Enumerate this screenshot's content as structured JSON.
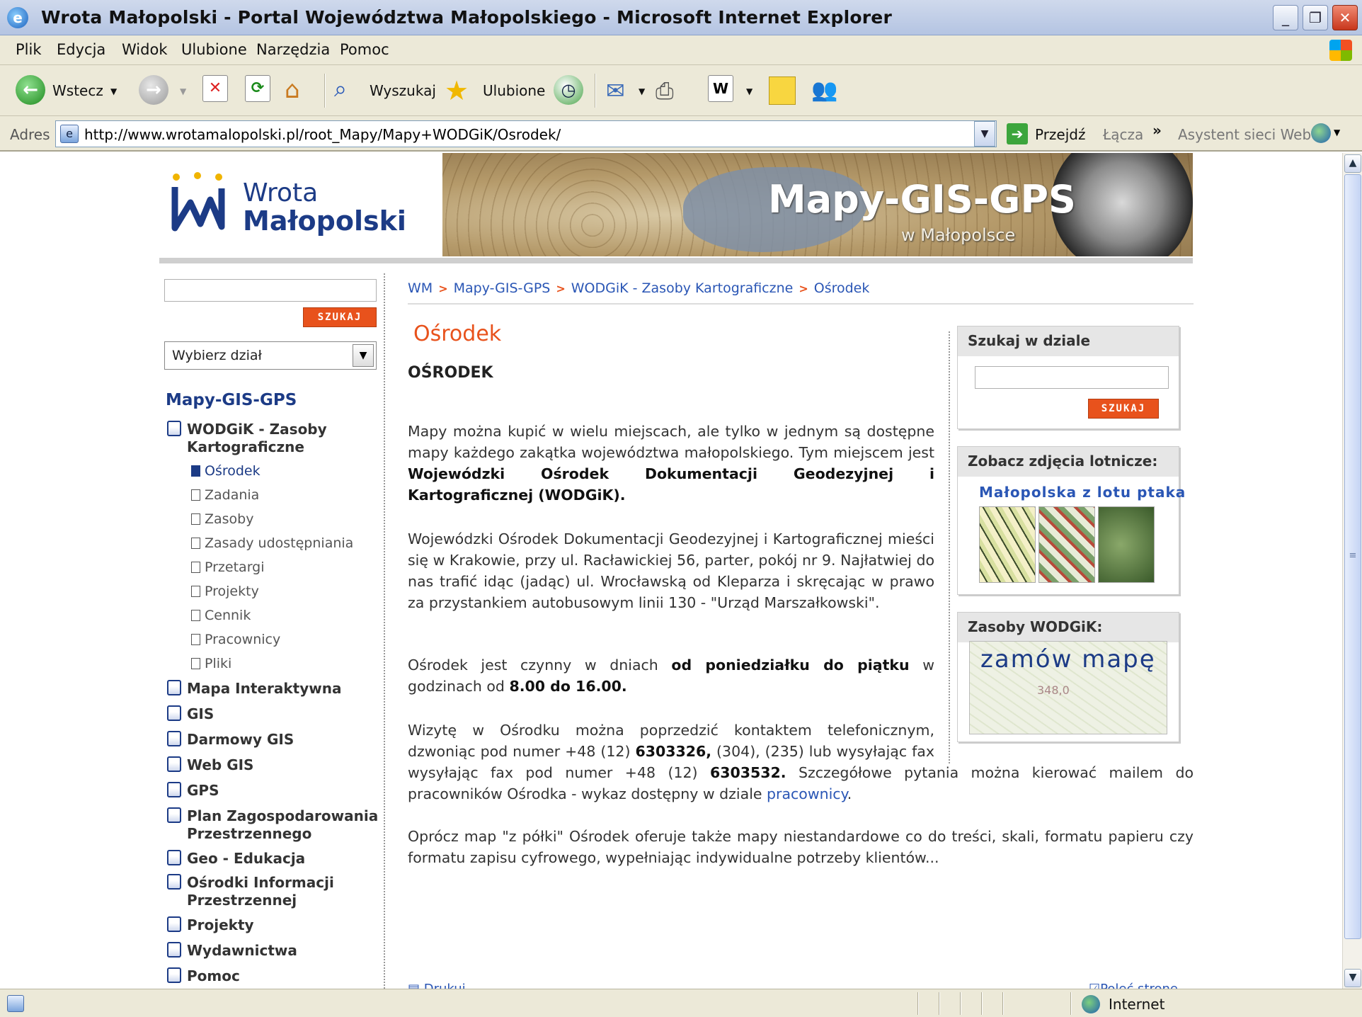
{
  "window": {
    "title": "Wrota Małopolski - Portal Województwa Małopolskiego - Microsoft Internet Explorer",
    "minimize": "_",
    "restore": "❐",
    "close": "✕"
  },
  "menu": [
    "Plik",
    "Edycja",
    "Widok",
    "Ulubione",
    "Narzędzia",
    "Pomoc"
  ],
  "toolbar": {
    "back": "Wstecz",
    "search": "Wyszukaj",
    "favorites": "Ulubione"
  },
  "address": {
    "label": "Adres",
    "url": "http://www.wrotamalopolski.pl/root_Mapy/Mapy+WODGiK/Osrodek/",
    "go": "Przejdź",
    "links": "Łącza",
    "chevron": "»",
    "assistant": "Asystent sieci Web"
  },
  "status": {
    "zone": "Internet"
  },
  "banner": {
    "logo_line1": "Wrota",
    "logo_line2": "Małopolski",
    "title": "Mapy-GIS-GPS",
    "subtitle": "w Małopolsce"
  },
  "left": {
    "search_button": "SZUKAJ",
    "select_value": "Wybierz dział",
    "heading": "Mapy-GIS-GPS",
    "nav_main": [
      {
        "label1": "WODGiK - Zasoby",
        "label2": "Kartograficzne"
      },
      {
        "label1": "Mapa Interaktywna"
      },
      {
        "label1": "GIS"
      },
      {
        "label1": "Darmowy GIS"
      },
      {
        "label1": "Web GIS"
      },
      {
        "label1": "GPS"
      },
      {
        "label1": "Plan Zagospodarowania",
        "label2": "Przestrzennego"
      },
      {
        "label1": "Geo - Edukacja"
      },
      {
        "label1": "Ośrodki Informacji",
        "label2": "Przestrzennej"
      },
      {
        "label1": "Projekty"
      },
      {
        "label1": "Wydawnictwa"
      },
      {
        "label1": "Pomoc"
      }
    ],
    "sub_items": [
      "Ośrodek",
      "Zadania",
      "Zasoby",
      "Zasady udostępniania",
      "Przetargi",
      "Projekty",
      "Cennik",
      "Pracownicy",
      "Pliki"
    ]
  },
  "breadcrumb": [
    "WM",
    "Mapy-GIS-GPS",
    "WODGiK - Zasoby Kartograficzne",
    "Ośrodek"
  ],
  "breadcrumb_sep": ">",
  "main": {
    "title": "Ośrodek",
    "subtitle": "OŚRODEK",
    "p1_a": "Mapy można kupić w wielu miejscach, ale tylko w jednym są dostępne mapy każdego zakątka województwa małopolskiego. Tym miejscem jest ",
    "p1_b": "Wojewódzki Ośrodek Dokumentacji Geodezyjnej i Kartograficznej (WODGiK).",
    "p2": "Wojewódzki Ośrodek Dokumentacji Geodezyjnej i Kartograficznej mieści się w Krakowie, przy ul. Racławickiej 56, parter, pokój nr 9. Najłatwiej do nas trafić idąc (jadąc) ul. Wrocławską od Kleparza i skręcając w prawo za przystankiem autobusowym linii 130 - \"Urząd Marszałkowski\".",
    "p3_a": "Ośrodek jest czynny w dniach ",
    "p3_b": "od poniedziałku do piątku",
    "p3_c": " w godzinach od ",
    "p3_d": "8.00 do 16.00.",
    "p4_a": "Wizytę w Ośrodku można poprzedzić kontaktem telefonicznym, dzwoniąc pod numer +48 (12) ",
    "p4_b": "6303326,",
    "p4_c": " (304), (235) lub wysyłając fax pod numer +48 (12) ",
    "p4_d": "6303532.",
    "p4_e": " Szczegółowe pytania można kierować mailem do pracowników Ośrodka - wykaz dostępny w dziale ",
    "p4_link": "pracownicy",
    "p4_f": ".",
    "p5": "Oprócz map \"z półki\" Ośrodek oferuje także mapy niestandardowe co do treści, skali, formatu papieru czy formatu zapisu cyfrowego, wypełniając indywidualne potrzeby klientów...",
    "print": "Drukuj",
    "recommend": "Poleć stronę"
  },
  "right": {
    "box1_title": "Szukaj w dziale",
    "box1_button": "SZUKAJ",
    "box2_title": "Zobacz zdjęcia lotnicze:",
    "box2_link": "Małopolska z lotu ptaka",
    "box3_title": "Zasoby WODGiK:",
    "box3_text": "zamów mapę",
    "box3_map_label": "348,0"
  }
}
